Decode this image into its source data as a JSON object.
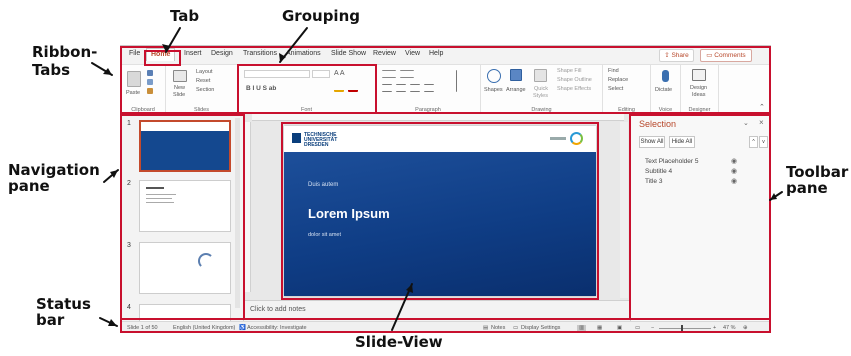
{
  "annotations": {
    "tab": "Tab",
    "grouping": "Grouping",
    "ribbon_tabs_1": "Ribbon-",
    "ribbon_tabs_2": "Tabs",
    "navigation_1": "Navigation",
    "navigation_2": "pane",
    "toolbar_1": "Toolbar",
    "toolbar_2": "pane",
    "status_1": "Status",
    "status_2": "bar",
    "slide_view": "Slide-View"
  },
  "tabs": [
    "File",
    "Home",
    "Insert",
    "Design",
    "Transitions",
    "Animations",
    "Slide Show",
    "Review",
    "View",
    "Help"
  ],
  "active_tab": "Home",
  "share_label": "Share",
  "comments_label": "Comments",
  "ribbon": {
    "clipboard": "Clipboard",
    "slides": "Slides",
    "font": "Font",
    "paragraph": "Paragraph",
    "drawing": "Drawing",
    "editing": "Editing",
    "voice": "Voice",
    "designer": "Designer",
    "paste": "Paste",
    "new_slide_1": "New",
    "new_slide_2": "Slide",
    "layout": "Layout",
    "reset": "Reset",
    "section": "Section",
    "font_buttons": "B  I  U  S  ab",
    "font_size_buttons": "A  A",
    "shapes": "Shapes",
    "arrange": "Arrange",
    "quick_styles_1": "Quick",
    "quick_styles_2": "Styles",
    "shape_fill": "Shape Fill",
    "shape_outline": "Shape Outline",
    "shape_effects": "Shape Effects",
    "find": "Find",
    "replace": "Replace",
    "select": "Select",
    "dictate": "Dictate",
    "design_ideas_1": "Design",
    "design_ideas_2": "Ideas"
  },
  "nav": {
    "slide_numbers": [
      "1",
      "2",
      "3",
      "4"
    ]
  },
  "slide": {
    "logo_lines": [
      "TECHNISCHE",
      "UNIVERSITÄT",
      "DRESDEN"
    ],
    "subtitle_small": "Duis autem",
    "title": "Lorem Ipsum",
    "footer_small": "dolor sit amet"
  },
  "notes_placeholder": "Click to add notes",
  "selection_pane": {
    "title": "Selection",
    "show_all": "Show All",
    "hide_all": "Hide All",
    "items": [
      "Text Placeholder 5",
      "Subtitle 4",
      "Title 3"
    ]
  },
  "status": {
    "slide_of": "Slide 1 of 50",
    "language": "English (United Kingdom)",
    "accessibility": "Accessibility: Investigate",
    "notes": "Notes",
    "display_settings": "Display Settings",
    "zoom": "47 %"
  },
  "colors": {
    "annotation_red": "#c8102e",
    "accent": "#b7472a",
    "slide_blue": "#0f3d85"
  }
}
